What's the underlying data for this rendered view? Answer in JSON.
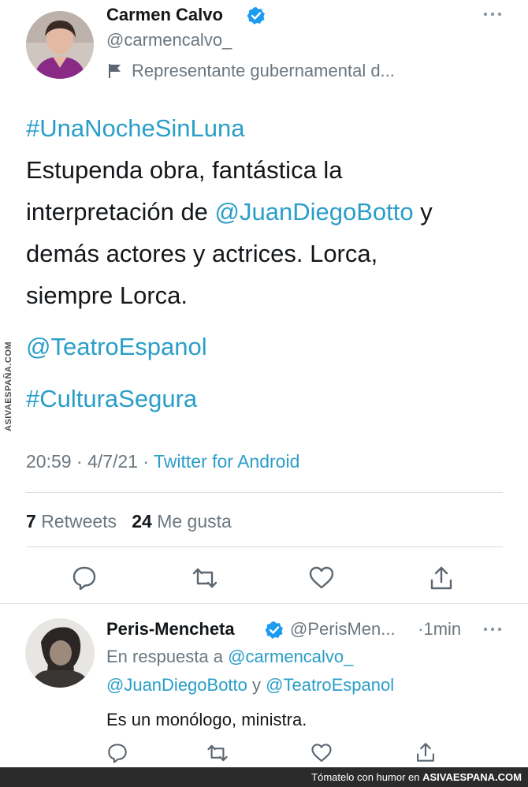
{
  "watermark": {
    "side_text": "ASIVAESPAÑA.COM"
  },
  "tweet": {
    "author_name": "Carmen Calvo",
    "author_handle": "@carmencalvo_",
    "bio": "Representante gubernamental d...",
    "more_icon": "more-dots-icon",
    "line1_hashtag": "#UnaNocheSinLuna",
    "line2": "Estupenda obra, fantástica la",
    "line3_prefix": "interpretación de ",
    "line3_mention": "@JuanDiegoBotto",
    "line3_suffix": " y",
    "line4": "demás actores y actrices. Lorca,",
    "line5": "siempre Lorca.",
    "mention_teatro": "@TeatroEspanol",
    "hashtag_cultura": "#CulturaSegura",
    "time": "20:59",
    "date": "4/7/21",
    "source": "Twitter for Android",
    "retweets_count": "7",
    "retweets_label": "Retweets",
    "likes_count": "24",
    "likes_label": "Me gusta"
  },
  "reply": {
    "author_name": "Peris-Mencheta",
    "author_handle": "@PerisMen...",
    "time": "1min",
    "replying_label": "En respuesta a",
    "replying_to_1": "@carmencalvo_",
    "replying_to_2": "@JuanDiegoBotto",
    "replying_and": "y",
    "replying_to_3": "@TeatroEspanol",
    "text": "Es un monólogo, ministra."
  },
  "footer": {
    "text_prefix": "Tómatelo con humor en ",
    "site": "ASIVAESPANA.COM"
  },
  "colors": {
    "link": "#2a9ec8",
    "verified": "#1d9bf0",
    "text": "#14171a",
    "grey": "#6b7780"
  }
}
